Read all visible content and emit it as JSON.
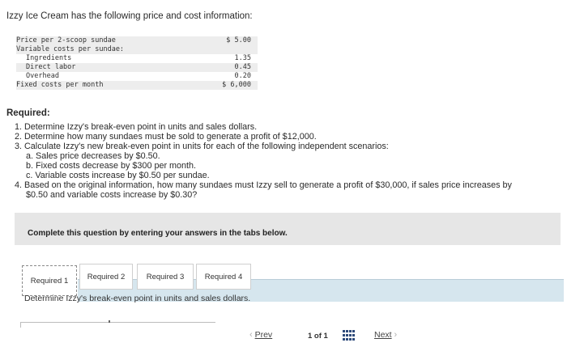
{
  "intro": "Izzy Ice Cream has the following price and cost information:",
  "price_table": {
    "rows": [
      {
        "label": "Price per 2-scoop sundae",
        "value": "$ 5.00"
      },
      {
        "label": "Variable costs per sundae:",
        "value": ""
      },
      {
        "label": "Ingredients",
        "value": "1.35"
      },
      {
        "label": "Direct labor",
        "value": "0.45"
      },
      {
        "label": "Overhead",
        "value": "0.20"
      },
      {
        "label": "Fixed costs per month",
        "value": "$ 6,000"
      }
    ]
  },
  "required": {
    "heading": "Required:",
    "items": [
      "1. Determine Izzy's break-even point in units and sales dollars.",
      "2. Determine how many sundaes must be sold to generate a profit of $12,000.",
      "3. Calculate Izzy's new break-even point in units for each of the following independent scenarios:",
      "a. Sales price decreases by $0.50.",
      "b. Fixed costs decrease by $300 per month.",
      "c. Variable costs increase by $0.50 per sundae.",
      "4. Based on the original information, how many sundaes must Izzy sell to generate a profit of $30,000, if sales price increases by",
      "$0.50 and variable costs increase by $0.30?"
    ]
  },
  "panel": {
    "text": "Complete this question by entering your answers in the tabs below."
  },
  "tabs": [
    {
      "label": "Required 1",
      "active": true
    },
    {
      "label": "Required 2",
      "active": false
    },
    {
      "label": "Required 3",
      "active": false
    },
    {
      "label": "Required 4",
      "active": false
    }
  ],
  "instruction": "Determine Izzy's break-even point in units and sales dollars.",
  "pagination": {
    "prev_label": "Prev",
    "page_text": "1 of 1",
    "next_label": "Next",
    "prev_arrow": "‹",
    "next_arrow": "›"
  },
  "colors": {
    "tab_bar": "#d6e6ee",
    "panel": "#e6e6e6",
    "grid_icon": "#2d4a7a"
  }
}
